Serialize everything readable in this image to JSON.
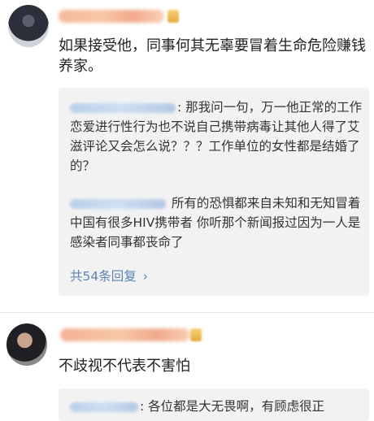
{
  "comments": [
    {
      "text": "如果接受他，同事何其无辜要冒着生命危险赚钱养家。",
      "replies": [
        {
          "text": ": 那我问一句，万一他正常的工作恋爱进行性行为也不说自己携带病毒让其他人得了艾滋评论又会怎么说？？？工作单位的女性都是结婚了的？"
        },
        {
          "text": " 所有的恐惧都来自未知和无知冒着 中国有很多HIV携带者 你听那个新闻报过因为一人是感染者同事都丧命了"
        }
      ],
      "more_replies": "共54条回复",
      "more_icon": "chevron-right-icon"
    },
    {
      "text": "不歧视不代表不害怕",
      "replies": [
        {
          "text": ": 各位都是大无畏啊，有顾虑很正"
        }
      ]
    }
  ],
  "colors": {
    "link": "#5b84b6",
    "reply_background": "#f2f2f2"
  }
}
